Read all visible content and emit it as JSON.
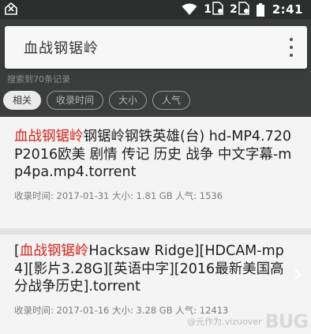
{
  "status_bar": {
    "sim1_label": "1",
    "sim2_label": "2",
    "time": "2:41"
  },
  "search": {
    "query": "血战钢锯岭"
  },
  "result_summary": "搜索到70条记录",
  "sort_chips": [
    {
      "label": "相关",
      "active": true
    },
    {
      "label": "收录时间",
      "active": false
    },
    {
      "label": "大小",
      "active": false
    },
    {
      "label": "人气",
      "active": false
    }
  ],
  "results": [
    {
      "title_highlight": "血战钢锯岭",
      "title_rest": "钢锯岭钢铁英雄(台) hd-MP4.720P2016欧美 剧情 传记 历史 战争 中文字幕-mp4pa.mp4.torrent",
      "meta": "收录时间: 2017-01-31 大小: 1.81 GB 人气: 1536"
    },
    {
      "title_prefix": "[",
      "title_highlight": "血战钢锯岭",
      "title_rest": "Hacksaw Ridge][HDCAM-mp4][影片3.28G][英语中字][2016最新美国高分战争历史].torrent",
      "meta": "收录时间: 2017-01-16 大小: 3.28 GB 人气: 12413"
    }
  ],
  "watermark": {
    "text": "@元作为.vizuover",
    "logo": "BUG"
  },
  "colors": {
    "highlight": "#d4241c",
    "background": "#3b3d3c",
    "card": "#f4f4f4"
  }
}
